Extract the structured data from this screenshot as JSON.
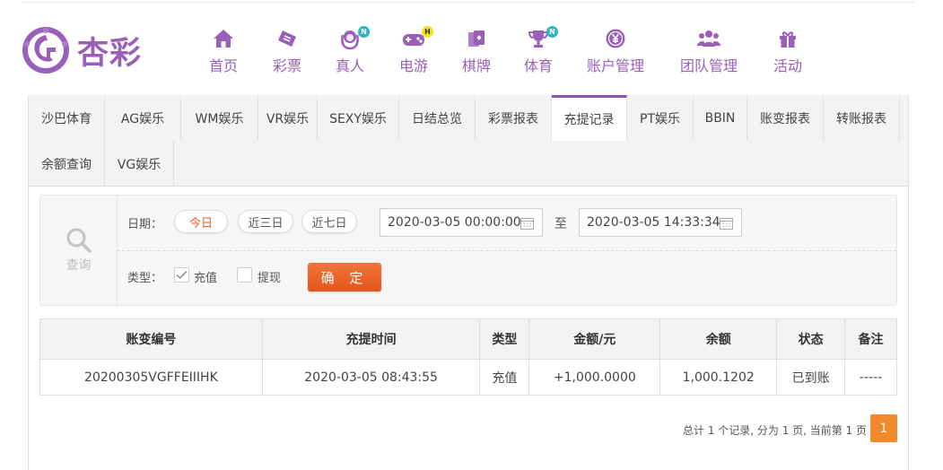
{
  "brand": {
    "logo_text": "杏彩",
    "accent": "#9a5fb8",
    "orange": "#e35f22"
  },
  "nav": [
    {
      "label": "首页",
      "icon": "home-icon",
      "badge": ""
    },
    {
      "label": "彩票",
      "icon": "ticket-icon",
      "badge": ""
    },
    {
      "label": "真人",
      "icon": "live-dealer-icon",
      "badge": "N"
    },
    {
      "label": "电游",
      "icon": "gamepad-icon",
      "badge": "H"
    },
    {
      "label": "棋牌",
      "icon": "cards-icon",
      "badge": ""
    },
    {
      "label": "体育",
      "icon": "trophy-icon",
      "badge": "N"
    },
    {
      "label": "账户管理",
      "icon": "yen-coin-icon",
      "badge": ""
    },
    {
      "label": "团队管理",
      "icon": "team-icon",
      "badge": ""
    },
    {
      "label": "活动",
      "icon": "gift-icon",
      "badge": ""
    }
  ],
  "tabs": [
    "沙巴体育",
    "AG娱乐",
    "WM娱乐",
    "VR娱乐",
    "SEXY娱乐",
    "日结总览",
    "彩票报表",
    "充提记录",
    "PT娱乐",
    "BBIN",
    "账变报表",
    "转账报表",
    "余额查询",
    "VG娱乐"
  ],
  "active_tab": "充提记录",
  "filter": {
    "search_label": "查询",
    "date_label": "日期：",
    "quick_ranges": [
      "今日",
      "近三日",
      "近七日"
    ],
    "active_range": "今日",
    "start_date": "2020-03-05 00:00:00",
    "to_label": "至",
    "end_date": "2020-03-05 14:33:34",
    "type_label": "类型：",
    "type_options": [
      {
        "label": "充值",
        "checked": true
      },
      {
        "label": "提现",
        "checked": false
      }
    ],
    "confirm_label": "确 定"
  },
  "table": {
    "headers": [
      "账变编号",
      "充提时间",
      "类型",
      "金额/元",
      "余额",
      "状态",
      "备注"
    ],
    "rows": [
      [
        "20200305VGFFEIIIHK",
        "2020-03-05 08:43:55",
        "充值",
        "+1,000.0000",
        "1,000.1202",
        "已到账",
        "-----"
      ]
    ]
  },
  "pagination": {
    "summary": "总计 1 个记录, 分为 1 页, 当前第 1 页",
    "current_page": "1"
  }
}
